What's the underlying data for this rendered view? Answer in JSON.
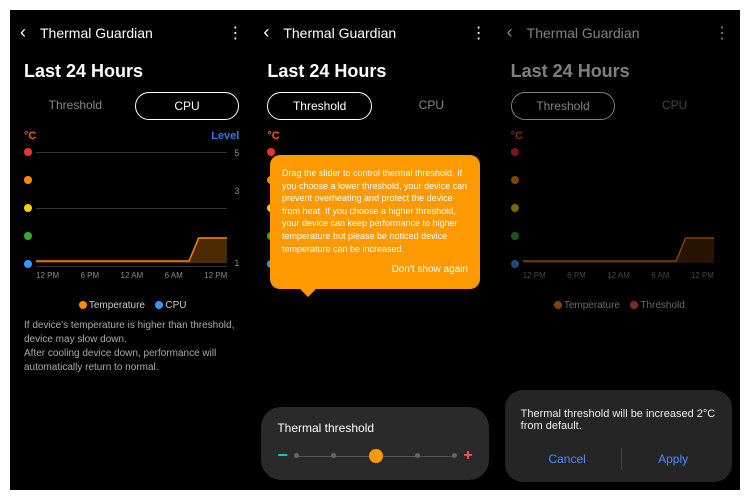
{
  "app": {
    "title": "Thermal Guardian"
  },
  "heading": "Last 24 Hours",
  "tabs": {
    "threshold": "Threshold",
    "cpu": "CPU"
  },
  "unit": "°C",
  "level_label": "Level",
  "levels": [
    "5",
    "3",
    "1"
  ],
  "xaxis": [
    "12 PM",
    "6 PM",
    "12 AM",
    "6 AM",
    "12 PM"
  ],
  "legend": {
    "temperature": "Temperature",
    "cpu": "CPU",
    "threshold": "Threshold"
  },
  "info": {
    "line1": "If device's temperature is higher than threshold, device may slow down.",
    "line2": "After cooling device down, performance will automatically return to normal."
  },
  "slider_title": "Thermal threshold",
  "tooltip": {
    "body": "Drag the slider to control thermal threshold. If you choose a lower threshold, your device can prevent overheating and protect the device from heat. If you choose a higher threshold, your device can keep performance to higher temperature but please be noticed device temperature can be increased.",
    "dismiss": "Don't show again"
  },
  "dialog": {
    "text": "Thermal threshold will be increased 2°C from default.",
    "cancel": "Cancel",
    "apply": "Apply"
  },
  "chart_data": {
    "type": "line",
    "series": [
      {
        "name": "Temperature",
        "color": "#f80",
        "values": [
          1,
          1,
          1,
          1,
          1,
          1,
          1,
          1,
          3,
          3
        ]
      },
      {
        "name": "CPU",
        "color": "#39f",
        "values": [
          5,
          5,
          5,
          5,
          5,
          5,
          5,
          5,
          5,
          5
        ]
      }
    ],
    "x": [
      "12 PM",
      "",
      "6 PM",
      "",
      "12 AM",
      "",
      "6 AM",
      "",
      "",
      "12 PM"
    ],
    "ylabel": "°C",
    "ylim": [
      1,
      5
    ]
  }
}
